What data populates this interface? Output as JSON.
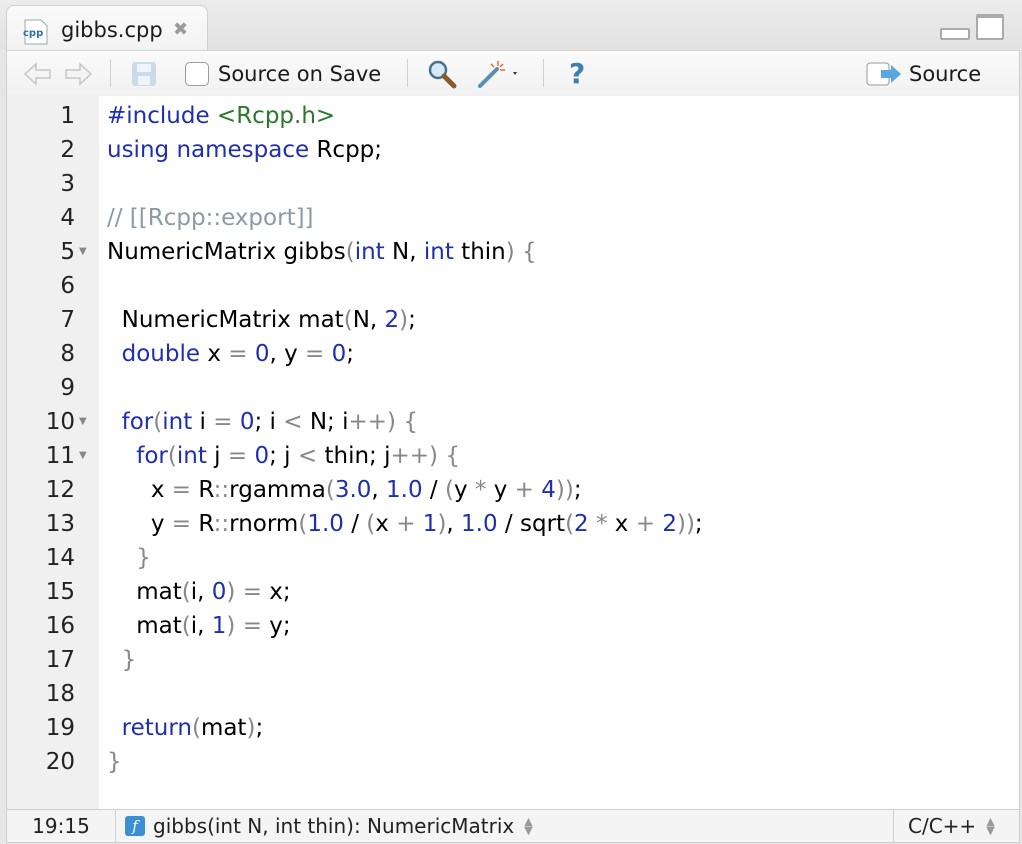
{
  "tab": {
    "filename": "gibbs.cpp",
    "icon": "cpp-file-icon",
    "close": "✖"
  },
  "toolbar": {
    "source_on_save": "Source on Save",
    "source_on_save_checked": false,
    "help": "?",
    "source": "Source"
  },
  "editor": {
    "lines": [
      {
        "n": "1",
        "fold": false,
        "tokens": [
          [
            "kw",
            "#include "
          ],
          [
            "str",
            "<Rcpp.h>"
          ]
        ]
      },
      {
        "n": "2",
        "fold": false,
        "tokens": [
          [
            "kw",
            "using namespace "
          ],
          [
            "",
            "Rcpp;"
          ]
        ]
      },
      {
        "n": "3",
        "fold": false,
        "tokens": []
      },
      {
        "n": "4",
        "fold": false,
        "tokens": [
          [
            "cm",
            "// [[Rcpp::export]]"
          ]
        ]
      },
      {
        "n": "5",
        "fold": true,
        "tokens": [
          [
            "",
            "NumericMatrix gibbs"
          ],
          [
            "op",
            "("
          ],
          [
            "kw",
            "int"
          ],
          [
            "",
            " N, "
          ],
          [
            "kw",
            "int"
          ],
          [
            "",
            " thin"
          ],
          [
            "op",
            ")"
          ],
          [
            "",
            " "
          ],
          [
            "op",
            "{"
          ]
        ]
      },
      {
        "n": "6",
        "fold": false,
        "tokens": []
      },
      {
        "n": "7",
        "fold": false,
        "tokens": [
          [
            "",
            "  NumericMatrix mat"
          ],
          [
            "op",
            "("
          ],
          [
            "",
            "N, "
          ],
          [
            "num",
            "2"
          ],
          [
            "op",
            ")"
          ],
          [
            "",
            ";"
          ]
        ]
      },
      {
        "n": "8",
        "fold": false,
        "tokens": [
          [
            "",
            "  "
          ],
          [
            "kw",
            "double"
          ],
          [
            "",
            " x "
          ],
          [
            "op",
            "="
          ],
          [
            "",
            " "
          ],
          [
            "num",
            "0"
          ],
          [
            "",
            ", y "
          ],
          [
            "op",
            "="
          ],
          [
            "",
            " "
          ],
          [
            "num",
            "0"
          ],
          [
            "",
            ";"
          ]
        ]
      },
      {
        "n": "9",
        "fold": false,
        "tokens": []
      },
      {
        "n": "10",
        "fold": true,
        "tokens": [
          [
            "",
            "  "
          ],
          [
            "kw",
            "for"
          ],
          [
            "op",
            "("
          ],
          [
            "kw",
            "int"
          ],
          [
            "",
            " i "
          ],
          [
            "op",
            "="
          ],
          [
            "",
            " "
          ],
          [
            "num",
            "0"
          ],
          [
            "",
            "; i "
          ],
          [
            "op",
            "<"
          ],
          [
            "",
            " N; i"
          ],
          [
            "op",
            "++"
          ],
          [
            "op",
            ")"
          ],
          [
            "",
            " "
          ],
          [
            "op",
            "{"
          ]
        ]
      },
      {
        "n": "11",
        "fold": true,
        "tokens": [
          [
            "",
            "    "
          ],
          [
            "kw",
            "for"
          ],
          [
            "op",
            "("
          ],
          [
            "kw",
            "int"
          ],
          [
            "",
            " j "
          ],
          [
            "op",
            "="
          ],
          [
            "",
            " "
          ],
          [
            "num",
            "0"
          ],
          [
            "",
            "; j "
          ],
          [
            "op",
            "<"
          ],
          [
            "",
            " thin; j"
          ],
          [
            "op",
            "++"
          ],
          [
            "op",
            ")"
          ],
          [
            "",
            " "
          ],
          [
            "op",
            "{"
          ]
        ]
      },
      {
        "n": "12",
        "fold": false,
        "tokens": [
          [
            "",
            "      x "
          ],
          [
            "op",
            "="
          ],
          [
            "",
            " R"
          ],
          [
            "op",
            "::"
          ],
          [
            "",
            "rgamma"
          ],
          [
            "op",
            "("
          ],
          [
            "num",
            "3.0"
          ],
          [
            "",
            ", "
          ],
          [
            "num",
            "1.0"
          ],
          [
            "",
            " / "
          ],
          [
            "op",
            "("
          ],
          [
            "",
            "y "
          ],
          [
            "op",
            "*"
          ],
          [
            "",
            " y "
          ],
          [
            "op",
            "+"
          ],
          [
            "",
            " "
          ],
          [
            "num",
            "4"
          ],
          [
            "op",
            "))"
          ],
          [
            "",
            ";"
          ]
        ]
      },
      {
        "n": "13",
        "fold": false,
        "tokens": [
          [
            "",
            "      y "
          ],
          [
            "op",
            "="
          ],
          [
            "",
            " R"
          ],
          [
            "op",
            "::"
          ],
          [
            "",
            "rnorm"
          ],
          [
            "op",
            "("
          ],
          [
            "num",
            "1.0"
          ],
          [
            "",
            " / "
          ],
          [
            "op",
            "("
          ],
          [
            "",
            "x "
          ],
          [
            "op",
            "+"
          ],
          [
            "",
            " "
          ],
          [
            "num",
            "1"
          ],
          [
            "op",
            ")"
          ],
          [
            "",
            ", "
          ],
          [
            "num",
            "1.0"
          ],
          [
            "",
            " / sqrt"
          ],
          [
            "op",
            "("
          ],
          [
            "num",
            "2"
          ],
          [
            "",
            " "
          ],
          [
            "op",
            "*"
          ],
          [
            "",
            " x "
          ],
          [
            "op",
            "+"
          ],
          [
            "",
            " "
          ],
          [
            "num",
            "2"
          ],
          [
            "op",
            "))"
          ],
          [
            "",
            ";"
          ]
        ]
      },
      {
        "n": "14",
        "fold": false,
        "tokens": [
          [
            "",
            "    "
          ],
          [
            "op",
            "}"
          ]
        ]
      },
      {
        "n": "15",
        "fold": false,
        "tokens": [
          [
            "",
            "    mat"
          ],
          [
            "op",
            "("
          ],
          [
            "",
            "i, "
          ],
          [
            "num",
            "0"
          ],
          [
            "op",
            ")"
          ],
          [
            "",
            " "
          ],
          [
            "op",
            "="
          ],
          [
            "",
            " x;"
          ]
        ]
      },
      {
        "n": "16",
        "fold": false,
        "tokens": [
          [
            "",
            "    mat"
          ],
          [
            "op",
            "("
          ],
          [
            "",
            "i, "
          ],
          [
            "num",
            "1"
          ],
          [
            "op",
            ")"
          ],
          [
            "",
            " "
          ],
          [
            "op",
            "="
          ],
          [
            "",
            " y;"
          ]
        ]
      },
      {
        "n": "17",
        "fold": false,
        "tokens": [
          [
            "",
            "  "
          ],
          [
            "op",
            "}"
          ]
        ]
      },
      {
        "n": "18",
        "fold": false,
        "tokens": []
      },
      {
        "n": "19",
        "fold": false,
        "tokens": [
          [
            "",
            "  "
          ],
          [
            "kw",
            "return"
          ],
          [
            "op",
            "("
          ],
          [
            "",
            "mat"
          ],
          [
            "op",
            ")"
          ],
          [
            "",
            ";"
          ]
        ]
      },
      {
        "n": "20",
        "fold": false,
        "tokens": [
          [
            "op",
            "}"
          ]
        ]
      }
    ]
  },
  "statusbar": {
    "position": "19:15",
    "function_badge": "f",
    "function": "gibbs(int N, int thin): NumericMatrix",
    "language": "C/C++"
  }
}
